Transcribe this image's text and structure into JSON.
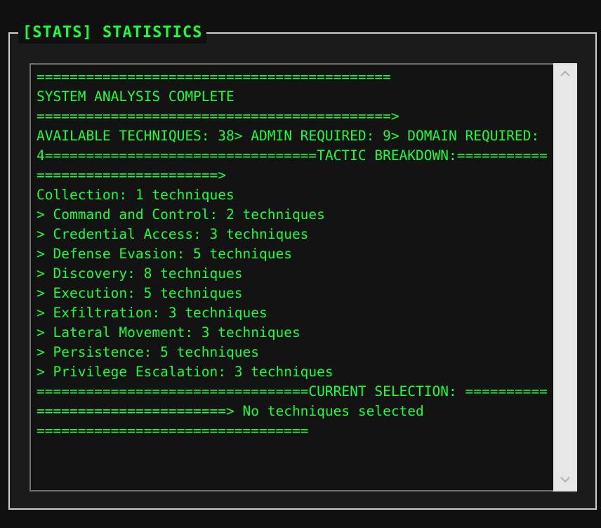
{
  "panel": {
    "title": "[STATS] STATISTICS"
  },
  "stats_log": {
    "text": "===========================================\nSYSTEM ANALYSIS COMPLETE\n===========================================>\nAVAILABLE TECHNIQUES: 38> ADMIN REQUIRED: 9> DOMAIN REQUIRED: 4=================================TACTIC BREAKDOWN:=================================>\nCollection: 1 techniques\n> Command and Control: 2 techniques\n> Credential Access: 3 techniques\n> Defense Evasion: 5 techniques\n> Discovery: 8 techniques\n> Execution: 5 techniques\n> Exfiltration: 3 techniques\n> Lateral Movement: 3 techniques\n> Persistence: 5 techniques\n> Privilege Escalation: 3 techniques\n=================================CURRENT SELECTION: =================================> No techniques selected\n================================="
  },
  "scrollbar": {
    "up_icon": "chevron-up-icon",
    "down_icon": "chevron-down-icon"
  },
  "colors": {
    "accent": "#18ff3a",
    "background": "#101010",
    "panel": "#1b1b1b",
    "textarea": "#131313",
    "scrollbar": "#e7e7e7"
  }
}
